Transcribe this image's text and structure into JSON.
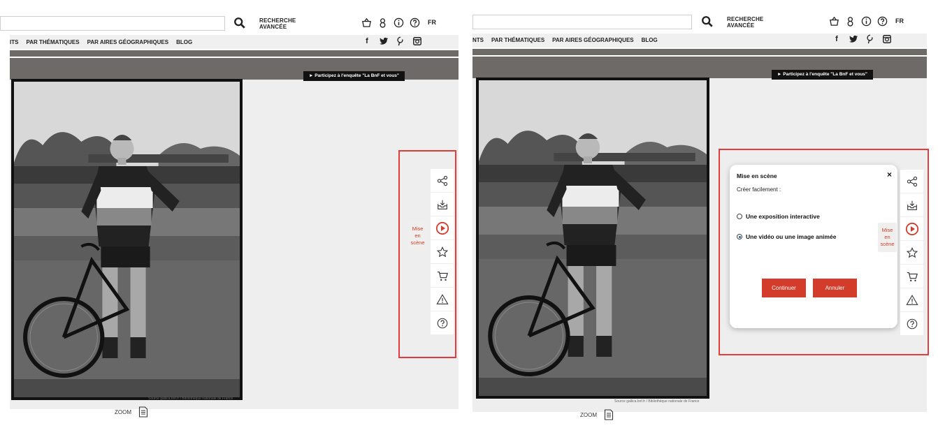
{
  "header": {
    "advanced_search_line1": "RECHERCHE",
    "advanced_search_line2": "AVANCÉE",
    "language": "FR"
  },
  "nav": {
    "left_items": [
      "ITS",
      "PAR THÉMATIQUES",
      "PAR AIRES GÉOGRAPHIQUES",
      "BLOG"
    ],
    "right_items": [
      "NTS",
      "PAR THÉMATIQUES",
      "PAR AIRES GÉOGRAPHIQUES",
      "BLOG"
    ]
  },
  "banner": {
    "survey": "► Participez à l'enquête \"La BnF et vous\""
  },
  "viewer": {
    "credit": "Source gallica.bnf.fr / Bibliothèque nationale de France",
    "zoom_label": "ZOOM"
  },
  "toolbar": {
    "tooltip_line1": "Mise",
    "tooltip_line2": "en",
    "tooltip_line3": "scène"
  },
  "dialog": {
    "title": "Mise en scène",
    "close": "×",
    "subtitle": "Créer facilement :",
    "option1": "Une exposition interactive",
    "option2": "Une vidéo ou une image animée",
    "selected": "option2",
    "continue_label": "Continuer",
    "cancel_label": "Annuler"
  },
  "colors": {
    "accent": "#d33c2a",
    "band": "#6d6a67",
    "highlight_box": "#e33b3b"
  }
}
